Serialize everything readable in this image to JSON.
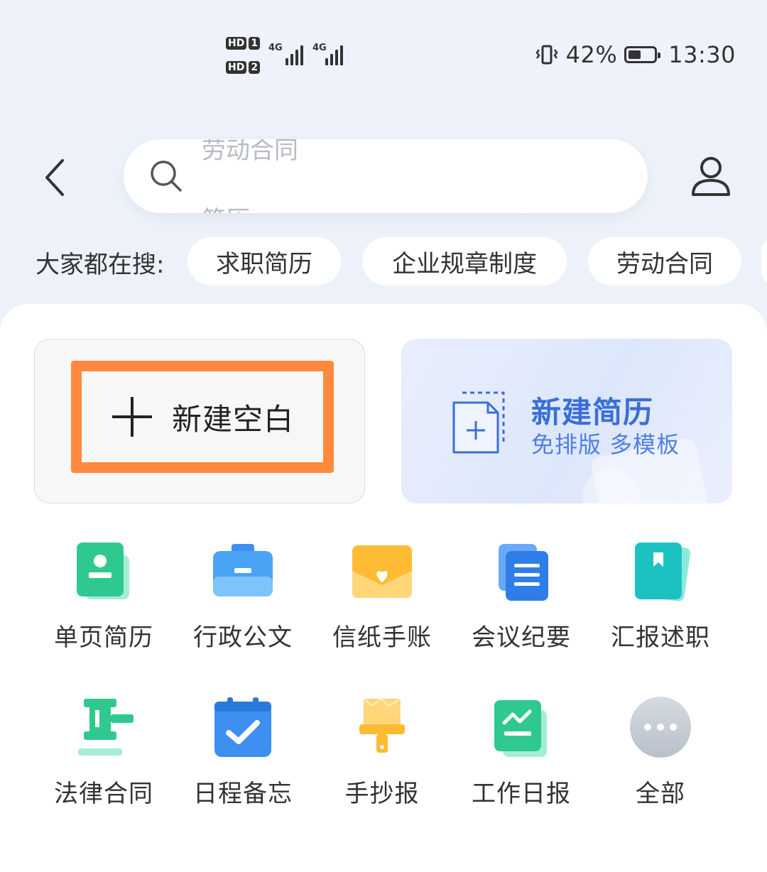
{
  "status_bar": {
    "battery_percent": "42%",
    "time": "13:30",
    "sim1_label": "HD",
    "sim1_num": "1",
    "sim2_label": "HD",
    "sim2_num": "2",
    "net1": "4G",
    "net2": "4G"
  },
  "search": {
    "placeholder_current": "劳动合同",
    "placeholder_next": "简历"
  },
  "hot": {
    "label": "大家都在搜:",
    "chips": [
      "求职简历",
      "企业规章制度",
      "劳动合同"
    ]
  },
  "actions": {
    "blank_label": "新建空白",
    "resume_title": "新建简历",
    "resume_subtitle": "免排版 多模板"
  },
  "tools": [
    {
      "label": "单页简历",
      "icon": "resume-icon"
    },
    {
      "label": "行政公文",
      "icon": "briefcase-icon"
    },
    {
      "label": "信纸手账",
      "icon": "envelope-heart-icon"
    },
    {
      "label": "会议纪要",
      "icon": "documents-icon"
    },
    {
      "label": "汇报述职",
      "icon": "bookmark-book-icon"
    },
    {
      "label": "法律合同",
      "icon": "gavel-icon"
    },
    {
      "label": "日程备忘",
      "icon": "calendar-check-icon"
    },
    {
      "label": "手抄报",
      "icon": "brush-icon"
    },
    {
      "label": "工作日报",
      "icon": "chart-doc-icon"
    },
    {
      "label": "全部",
      "icon": "more-icon"
    }
  ],
  "colors": {
    "accent_blue": "#3a6fd8",
    "highlight_orange": "#ff8a3d"
  }
}
